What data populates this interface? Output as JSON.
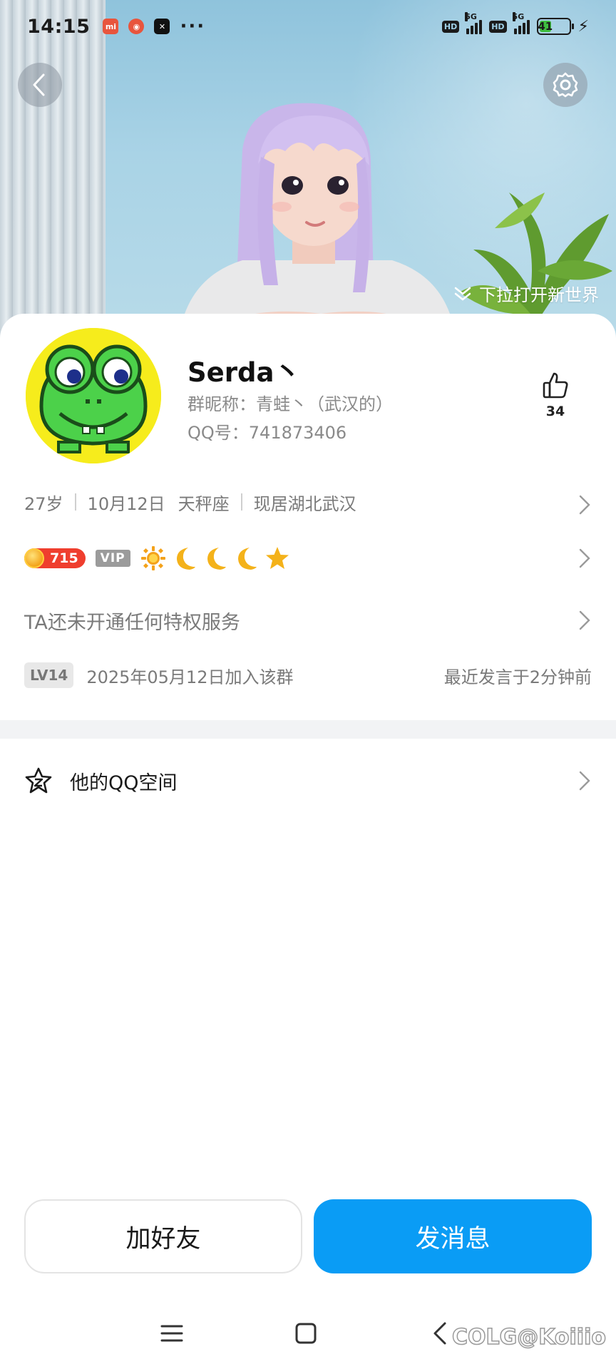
{
  "status_bar": {
    "time": "14:15",
    "more": "···",
    "network_label_1": "HD",
    "network_gen_1": "5G",
    "network_label_2": "HD",
    "network_gen_2": "5G",
    "battery": "41"
  },
  "cover": {
    "pull_hint": "下拉打开新世界",
    "back_icon": "back-chevron-icon",
    "settings_icon": "gear-icon"
  },
  "profile": {
    "nickname": "Serda丶",
    "group_nickname": "群昵称：青蛙丶（武汉的）",
    "qq_number": "QQ号：741873406",
    "likes": "34"
  },
  "info": {
    "age": "27岁",
    "birthday": "10月12日",
    "zodiac": "天秤座",
    "location": "现居湖北武汉"
  },
  "badges": {
    "coin_value": "715",
    "vip": "VIP",
    "level_icons": [
      "sun-icon",
      "moon-icon",
      "moon-icon",
      "moon-icon",
      "star-icon"
    ]
  },
  "privilege": {
    "text": "TA还未开通任何特权服务"
  },
  "group": {
    "level": "LV14",
    "joined": "2025年05月12日加入该群",
    "last_speak": "最近发言于2分钟前"
  },
  "qzone": {
    "label": "他的QQ空间"
  },
  "actions": {
    "add_friend": "加好友",
    "send_message": "发消息"
  },
  "watermark": "COLG@Koiiio",
  "colors": {
    "primary_blue": "#0a9cf5",
    "coin_red": "#ef3e2e",
    "avatar_yellow": "#f6ec1c"
  }
}
